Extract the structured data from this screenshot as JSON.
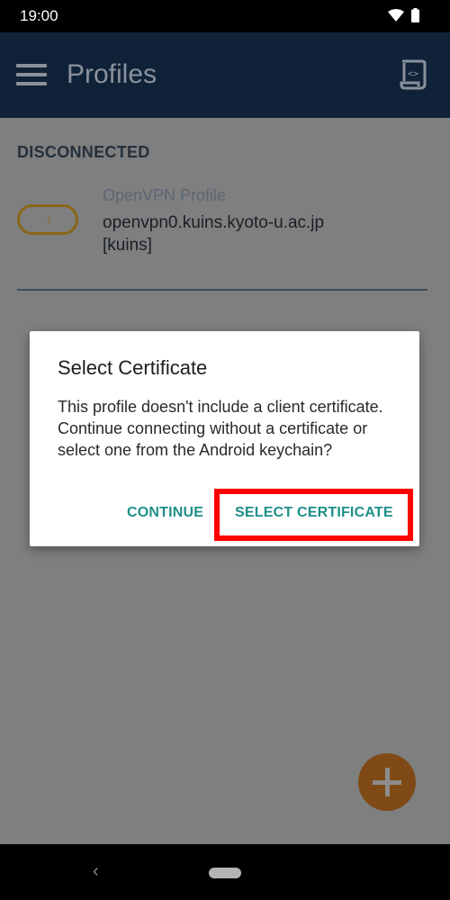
{
  "status_bar": {
    "time": "19:00"
  },
  "app_bar": {
    "title": "Profiles"
  },
  "section": {
    "header": "DISCONNECTED"
  },
  "profile": {
    "type": "OpenVPN Profile",
    "host": "openvpn0.kuins.kyoto-u.ac.jp",
    "user": "[kuins]"
  },
  "dialog": {
    "title": "Select Certificate",
    "message": "This profile doesn't include a client certificate. Continue connecting without a certificate or select one from the Android keychain?",
    "continue_label": "CONTINUE",
    "select_label": "SELECT CERTIFICATE"
  },
  "nav": {
    "back_glyph": "‹"
  },
  "colors": {
    "app_bar": "#102238",
    "accent": "#1d8f88",
    "fab": "#7f4a15",
    "toggle_border": "#8a6617",
    "highlight": "#ff0000"
  }
}
